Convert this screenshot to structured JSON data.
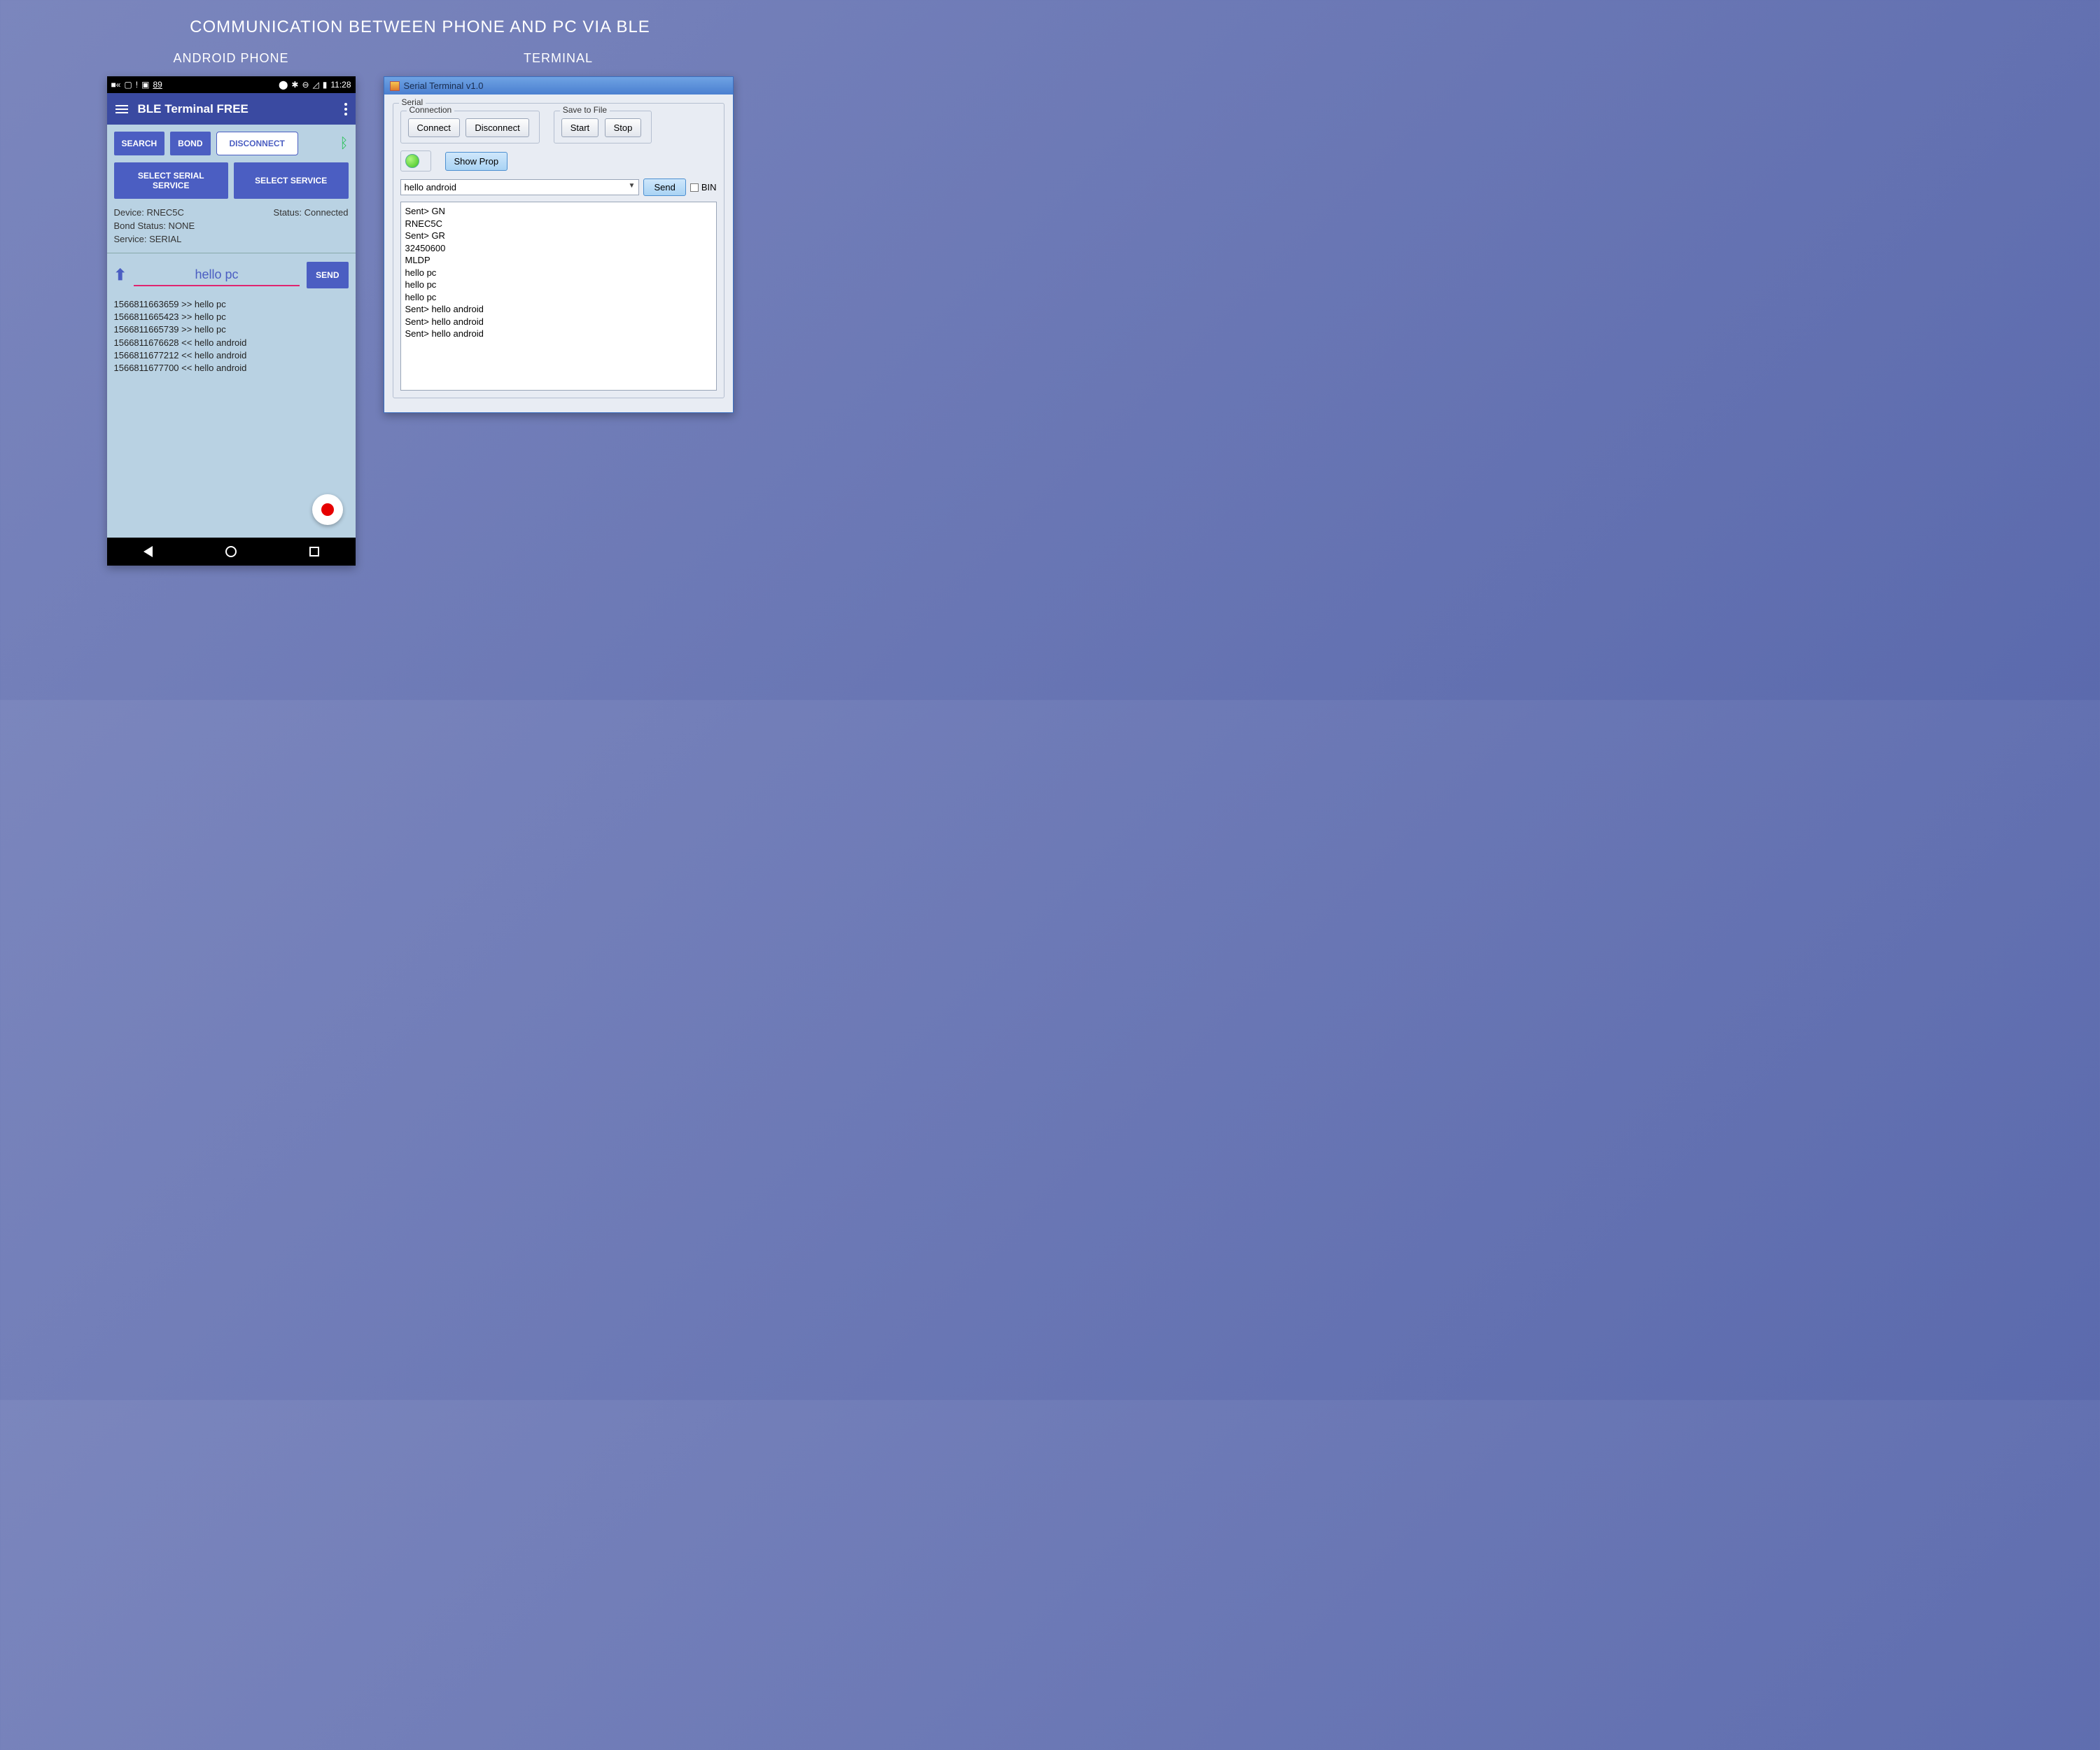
{
  "page": {
    "title": "COMMUNICATION BETWEEN PHONE AND PC VIA BLE",
    "left_label": "ANDROID PHONE",
    "right_label": "TERMINAL"
  },
  "phone": {
    "statusbar": {
      "battery": "89",
      "time": "11:28"
    },
    "app_title": "BLE Terminal FREE",
    "buttons": {
      "search": "SEARCH",
      "bond": "BOND",
      "disconnect": "DISCONNECT",
      "select_serial_service": "SELECT SERIAL SERVICE",
      "select_service": "SELECT SERVICE",
      "send": "SEND"
    },
    "info": {
      "device_label": "Device: RNEC5C",
      "status_label": "Status: Connected",
      "bond_status": "Bond Status: NONE",
      "service": "Service: SERIAL"
    },
    "input_value": "hello pc",
    "log": [
      "1566811663659 >> hello pc",
      "1566811665423 >> hello pc",
      "1566811665739 >> hello pc",
      "1566811676628 << hello android",
      "1566811677212 << hello android",
      "1566811677700 << hello android"
    ]
  },
  "terminal": {
    "window_title": "Serial Terminal v1.0",
    "group_serial": "Serial",
    "group_connection": "Connection",
    "group_savefile": "Save to File",
    "buttons": {
      "connect": "Connect",
      "disconnect": "Disconnect",
      "start": "Start",
      "stop": "Stop",
      "show_prop": "Show Prop",
      "send": "Send"
    },
    "input_value": "hello android",
    "bin_label": "BIN",
    "log": [
      "Sent> GN",
      "RNEC5C",
      "Sent> GR",
      "32450600",
      "MLDP",
      "hello pc",
      "hello pc",
      "hello pc",
      "Sent> hello android",
      "Sent> hello android",
      "Sent> hello android"
    ]
  }
}
